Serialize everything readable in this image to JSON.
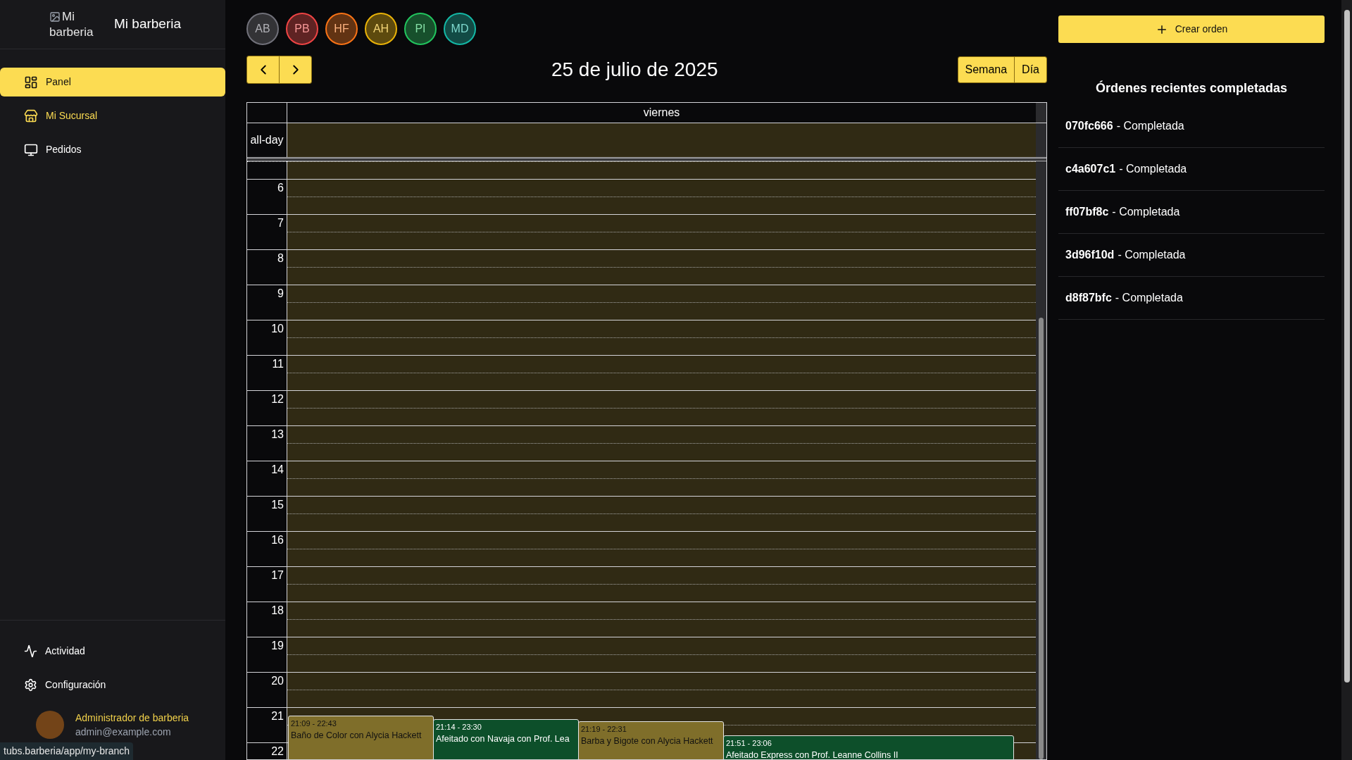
{
  "sidebar": {
    "logo_alt": "Mi barberia",
    "brand": "Mi barberia",
    "nav": [
      {
        "label": "Panel",
        "selected": true,
        "hovered": false
      },
      {
        "label": "Mi Sucursal",
        "selected": false,
        "hovered": true
      },
      {
        "label": "Pedidos",
        "selected": false,
        "hovered": false
      }
    ],
    "footer_nav": [
      {
        "label": "Actividad"
      },
      {
        "label": "Configuración"
      }
    ],
    "user": {
      "name": "Administrador de barberia",
      "email": "admin@example.com"
    }
  },
  "staff": [
    {
      "initials": "AB",
      "color": "#71717a"
    },
    {
      "initials": "PB",
      "color": "#ef4444"
    },
    {
      "initials": "HF",
      "color": "#f97316"
    },
    {
      "initials": "AH",
      "color": "#eab308"
    },
    {
      "initials": "PI",
      "color": "#22c55e"
    },
    {
      "initials": "MD",
      "color": "#14b8a6"
    }
  ],
  "calendar": {
    "title": "25 de julio de 2025",
    "views": [
      "Semana",
      "Día"
    ],
    "day_header": "viernes",
    "all_day_label": "all-day",
    "hours": [
      "6",
      "7",
      "8",
      "9",
      "10",
      "11",
      "12",
      "13",
      "14",
      "15",
      "16",
      "17",
      "18",
      "19",
      "20",
      "21",
      "22"
    ],
    "events": [
      {
        "time": "21:09 - 22:43",
        "title": "Baño de Color con Alycia Hackett",
        "color": "#7f6e2a"
      },
      {
        "time": "21:14 - 23:30",
        "title": "Afeitado con Navaja con Prof. Lea",
        "color": "#0d4f2a"
      },
      {
        "time": "21:19 - 22:31",
        "title": "Barba y Bigote con Alycia Hackett",
        "color": "#7f6e2a"
      },
      {
        "time": "21:51 - 23:06",
        "title": "Afeitado Express con Prof. Leanne Collins II",
        "color": "#0d4f2a"
      }
    ]
  },
  "create_button": "Crear orden",
  "recent_orders": {
    "title": "Órdenes recientes completadas",
    "items": [
      {
        "id": "070fc666",
        "status": "- Completada"
      },
      {
        "id": "c4a607c1",
        "status": "- Completada"
      },
      {
        "id": "ff07bf8c",
        "status": "- Completada"
      },
      {
        "id": "3d96f10d",
        "status": "- Completada"
      },
      {
        "id": "d8f87bfc",
        "status": "- Completada"
      }
    ]
  },
  "status_url": "tubs.barberia/app/my-branch"
}
